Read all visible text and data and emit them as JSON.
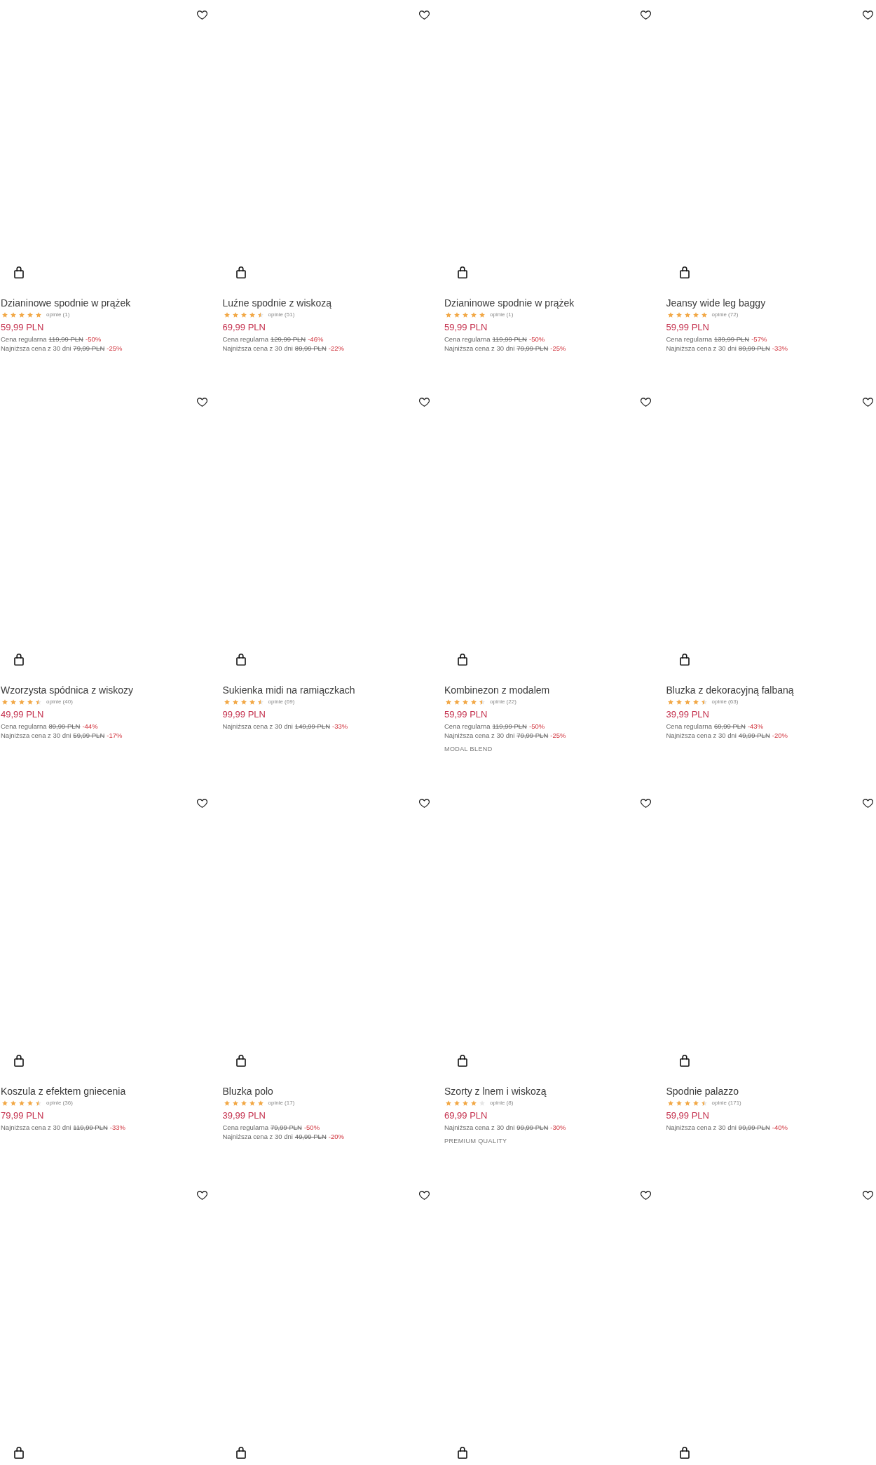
{
  "products": [
    {
      "wishlisted": false,
      "name": "Dzianinowe spodnie w prążek",
      "stars": 5,
      "reviews": "opinie (1)",
      "price": "59,99 PLN",
      "price_notes": [
        {
          "label": "Cena regularna",
          "old_price": "119,99 PLN",
          "discount": "-50%"
        },
        {
          "label": "Najniższa cena z 30 dni",
          "old_price": "79,99 PLN",
          "discount": "-25%"
        }
      ]
    },
    {
      "wishlisted": false,
      "name": "Luźne spodnie z wiskozą",
      "stars": 4.5,
      "reviews": "opinie (51)",
      "price": "69,99 PLN",
      "price_notes": [
        {
          "label": "Cena regularna",
          "old_price": "129,99 PLN",
          "discount": "-46%"
        },
        {
          "label": "Najniższa cena z 30 dni",
          "old_price": "89,99 PLN",
          "discount": "-22%"
        }
      ]
    },
    {
      "wishlisted": false,
      "name": "Dzianinowe spodnie w prążek",
      "stars": 5,
      "reviews": "opinie (1)",
      "price": "59,99 PLN",
      "price_notes": [
        {
          "label": "Cena regularna",
          "old_price": "119,99 PLN",
          "discount": "-50%"
        },
        {
          "label": "Najniższa cena z 30 dni",
          "old_price": "79,99 PLN",
          "discount": "-25%"
        }
      ]
    },
    {
      "wishlisted": false,
      "name": "Jeansy wide leg baggy",
      "stars": 5,
      "reviews": "opinie (72)",
      "price": "59,99 PLN",
      "price_notes": [
        {
          "label": "Cena regularna",
          "old_price": "139,99 PLN",
          "discount": "-57%"
        },
        {
          "label": "Najniższa cena z 30 dni",
          "old_price": "89,99 PLN",
          "discount": "-33%"
        }
      ]
    },
    {
      "wishlisted": false,
      "name": "Wzorzysta spódnica z wiskozy",
      "stars": 4.5,
      "reviews": "opinie (40)",
      "price": "49,99 PLN",
      "price_notes": [
        {
          "label": "Cena regularna",
          "old_price": "89,99 PLN",
          "discount": "-44%"
        },
        {
          "label": "Najniższa cena z 30 dni",
          "old_price": "59,99 PLN",
          "discount": "-17%"
        }
      ]
    },
    {
      "wishlisted": false,
      "name": "Sukienka midi na ramiączkach",
      "stars": 4.5,
      "reviews": "opinie (69)",
      "price": "99,99 PLN",
      "price_notes": [
        {
          "label": "Najniższa cena z 30 dni",
          "old_price": "149,99 PLN",
          "discount": "-33%"
        }
      ]
    },
    {
      "wishlisted": false,
      "name": "Kombinezon z modalem",
      "stars": 4.5,
      "reviews": "opinie (22)",
      "price": "59,99 PLN",
      "price_notes": [
        {
          "label": "Cena regularna",
          "old_price": "119,99 PLN",
          "discount": "-50%"
        },
        {
          "label": "Najniższa cena z 30 dni",
          "old_price": "79,99 PLN",
          "discount": "-25%"
        }
      ],
      "tag": "MODAL BLEND"
    },
    {
      "wishlisted": false,
      "name": "Bluzka z dekoracyjną falbaną",
      "stars": 4.5,
      "reviews": "opinie (63)",
      "price": "39,99 PLN",
      "price_notes": [
        {
          "label": "Cena regularna",
          "old_price": "69,99 PLN",
          "discount": "-43%"
        },
        {
          "label": "Najniższa cena z 30 dni",
          "old_price": "49,99 PLN",
          "discount": "-20%"
        }
      ]
    },
    {
      "wishlisted": false,
      "name": "Koszula z efektem gniecenia",
      "stars": 4.5,
      "reviews": "opinie (36)",
      "price": "79,99 PLN",
      "price_notes": [
        {
          "label": "Najniższa cena z 30 dni",
          "old_price": "119,99 PLN",
          "discount": "-33%"
        }
      ]
    },
    {
      "wishlisted": false,
      "name": "Bluzka polo",
      "stars": 5,
      "reviews": "opinie (17)",
      "price": "39,99 PLN",
      "price_notes": [
        {
          "label": "Cena regularna",
          "old_price": "79,99 PLN",
          "discount": "-50%"
        },
        {
          "label": "Najniższa cena z 30 dni",
          "old_price": "49,99 PLN",
          "discount": "-20%"
        }
      ]
    },
    {
      "wishlisted": false,
      "name": "Szorty z lnem i wiskozą",
      "stars": 4,
      "reviews": "opinie (8)",
      "price": "69,99 PLN",
      "price_notes": [
        {
          "label": "Najniższa cena z 30 dni",
          "old_price": "99,99 PLN",
          "discount": "-30%"
        }
      ],
      "tag": "PREMIUM QUALITY"
    },
    {
      "wishlisted": false,
      "name": "Spodnie palazzo",
      "stars": 4.5,
      "reviews": "opinie (171)",
      "price": "59,99 PLN",
      "price_notes": [
        {
          "label": "Najniższa cena z 30 dni",
          "old_price": "99,99 PLN",
          "discount": "-40%"
        }
      ]
    },
    {
      "wishlisted": false
    },
    {
      "wishlisted": false
    },
    {
      "wishlisted": false
    },
    {
      "wishlisted": false
    }
  ]
}
